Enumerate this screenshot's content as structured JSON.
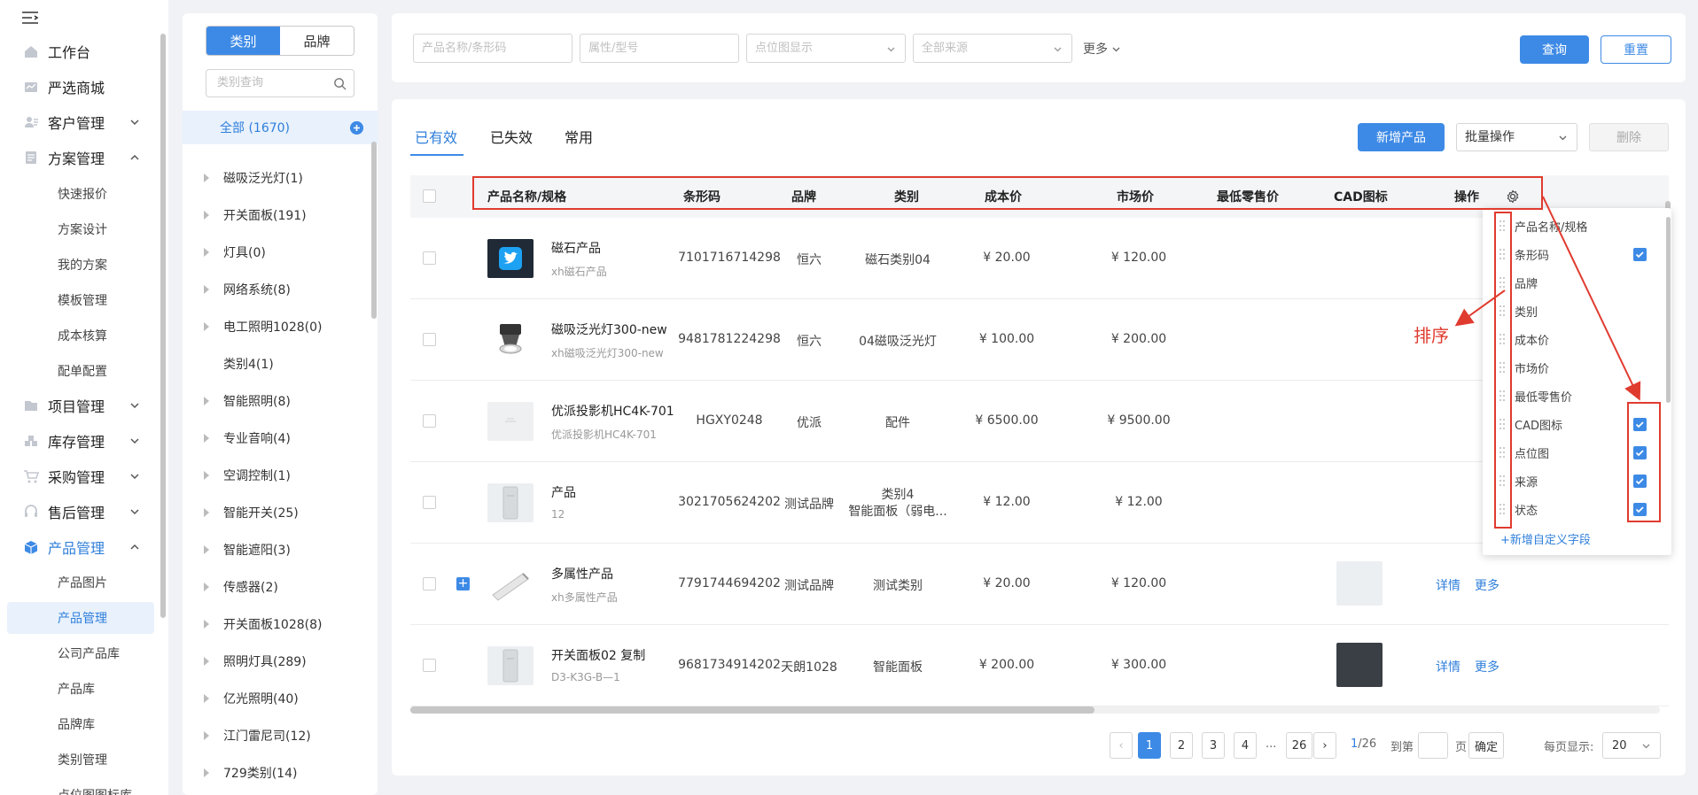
{
  "nav": {
    "items": [
      {
        "label": "工作台",
        "icon": "home-icon"
      },
      {
        "label": "严选商城",
        "icon": "store-icon"
      },
      {
        "label": "客户管理",
        "icon": "customer-icon",
        "chevron": "down"
      },
      {
        "label": "方案管理",
        "icon": "plan-icon",
        "chevron": "up"
      },
      {
        "label": "项目管理",
        "icon": "project-icon",
        "chevron": "down"
      },
      {
        "label": "库存管理",
        "icon": "inventory-icon",
        "chevron": "down"
      },
      {
        "label": "采购管理",
        "icon": "cart-icon",
        "chevron": "down"
      },
      {
        "label": "售后管理",
        "icon": "headset-icon",
        "chevron": "down"
      },
      {
        "label": "产品管理",
        "icon": "box-icon",
        "chevron": "up",
        "active": true
      }
    ],
    "plan_subs": [
      "快速报价",
      "方案设计",
      "我的方案",
      "模板管理",
      "成本核算",
      "配单配置"
    ],
    "product_subs": [
      "产品图片",
      "产品管理",
      "公司产品库",
      "产品库",
      "品牌库",
      "类别管理",
      "点位图图标库"
    ],
    "active_sub": "产品管理"
  },
  "category": {
    "tabs": [
      "类别",
      "品牌"
    ],
    "search_placeholder": "类别查询",
    "all": "全部 (1670)",
    "items": [
      {
        "label": "磁吸泛光灯(1)",
        "tri": true
      },
      {
        "label": "开关面板(191)",
        "tri": true
      },
      {
        "label": "灯具(0)",
        "tri": true
      },
      {
        "label": "网络系统(8)",
        "tri": true
      },
      {
        "label": "电工照明1028(0)",
        "tri": true
      },
      {
        "label": "类别4(1)",
        "tri": false
      },
      {
        "label": "智能照明(8)",
        "tri": true
      },
      {
        "label": "专业音响(4)",
        "tri": true
      },
      {
        "label": "空调控制(1)",
        "tri": true
      },
      {
        "label": "智能开关(25)",
        "tri": true
      },
      {
        "label": "智能遮阳(3)",
        "tri": true
      },
      {
        "label": "传感器(2)",
        "tri": true
      },
      {
        "label": "开关面板1028(8)",
        "tri": true
      },
      {
        "label": "照明灯具(289)",
        "tri": true
      },
      {
        "label": "亿光照明(40)",
        "tri": true
      },
      {
        "label": "江门雷尼司(12)",
        "tri": true
      },
      {
        "label": "729类别(14)",
        "tri": true
      }
    ]
  },
  "filters": {
    "name_placeholder": "产品名称/条形码",
    "attr_placeholder": "属性/型号",
    "point_placeholder": "点位图显示",
    "source_placeholder": "全部来源",
    "more": "更多",
    "query": "查询",
    "reset": "重置"
  },
  "main": {
    "tabs": [
      "已有效",
      "已失效",
      "常用"
    ],
    "add": "新增产品",
    "batch": "批量操作",
    "delete": "删除",
    "headers": {
      "name": "产品名称/规格",
      "barcode": "条形码",
      "brand": "品牌",
      "category": "类别",
      "cost": "成本价",
      "market": "市场价",
      "retail": "最低零售价",
      "cad": "CAD图标",
      "ops": "操作"
    },
    "rows": [
      {
        "name": "磁石产品",
        "sub": "xh磁石产品",
        "barcode": "7101716714298",
        "brand": "恒六",
        "category": "磁石类别04",
        "category2": "",
        "cost": "¥ 20.00",
        "market": "¥ 120.00",
        "thumb": "twitter",
        "expand": false,
        "ops": false
      },
      {
        "name": "磁吸泛光灯300-new",
        "sub": "xh磁吸泛光灯300-new",
        "barcode": "9481781224298",
        "brand": "恒六",
        "category": "04磁吸泛光灯",
        "category2": "",
        "cost": "¥ 100.00",
        "market": "¥ 200.00",
        "thumb": "spotlight",
        "expand": false,
        "ops": false
      },
      {
        "name": "优派投影机HC4K-701",
        "sub": "优派投影机HC4K-701",
        "barcode": "HGXY0248",
        "brand": "优派",
        "category": "配件",
        "category2": "",
        "cost": "¥ 6500.00",
        "market": "¥ 9500.00",
        "thumb": "blank",
        "expand": false,
        "ops": false
      },
      {
        "name": "产品",
        "sub": "12",
        "barcode": "3021705624202",
        "brand": "测试品牌",
        "category": "类别4",
        "category2": "智能面板（弱电...",
        "cost": "¥ 12.00",
        "market": "¥ 12.00",
        "thumb": "panel",
        "expand": false,
        "ops": false
      },
      {
        "name": "多属性产品",
        "sub": "xh多属性产品",
        "barcode": "7791744694202",
        "brand": "测试品牌",
        "category": "测试类别",
        "category2": "",
        "cost": "¥ 20.00",
        "market": "¥ 120.00",
        "thumb": "tube",
        "expand": true,
        "ops": true
      },
      {
        "name": "开关面板02 复制",
        "sub": "D3-K3G-B—1",
        "barcode": "9681734914202",
        "brand": "天朗1028",
        "category": "智能面板",
        "category2": "",
        "cost": "¥ 200.00",
        "market": "¥ 300.00",
        "thumb": "panel",
        "expand": false,
        "ops": true
      }
    ],
    "detail": "详情",
    "more": "更多"
  },
  "pagination": {
    "pages": [
      "1",
      "2",
      "3",
      "4",
      "...",
      "26"
    ],
    "current": "1",
    "total": "/26",
    "goto_prefix": "到第",
    "goto_suffix": "页",
    "confirm": "确定",
    "page_size_label": "每页显示:",
    "page_size": "20"
  },
  "columns_dropdown": {
    "items": [
      {
        "label": "产品名称/规格",
        "checked": false
      },
      {
        "label": "条形码",
        "checked": true
      },
      {
        "label": "品牌",
        "checked": false
      },
      {
        "label": "类别",
        "checked": false
      },
      {
        "label": "成本价",
        "checked": false
      },
      {
        "label": "市场价",
        "checked": false
      },
      {
        "label": "最低零售价",
        "checked": false
      },
      {
        "label": "CAD图标",
        "checked": true
      },
      {
        "label": "点位图",
        "checked": true
      },
      {
        "label": "来源",
        "checked": true
      },
      {
        "label": "状态",
        "checked": true
      }
    ],
    "add_field": "+新增自定义字段"
  },
  "annotation": {
    "sort_label": "排序",
    "color": "#e03b2f"
  },
  "colors": {
    "accent": "#3d8ae6",
    "active_bg": "#e8f1fc"
  }
}
